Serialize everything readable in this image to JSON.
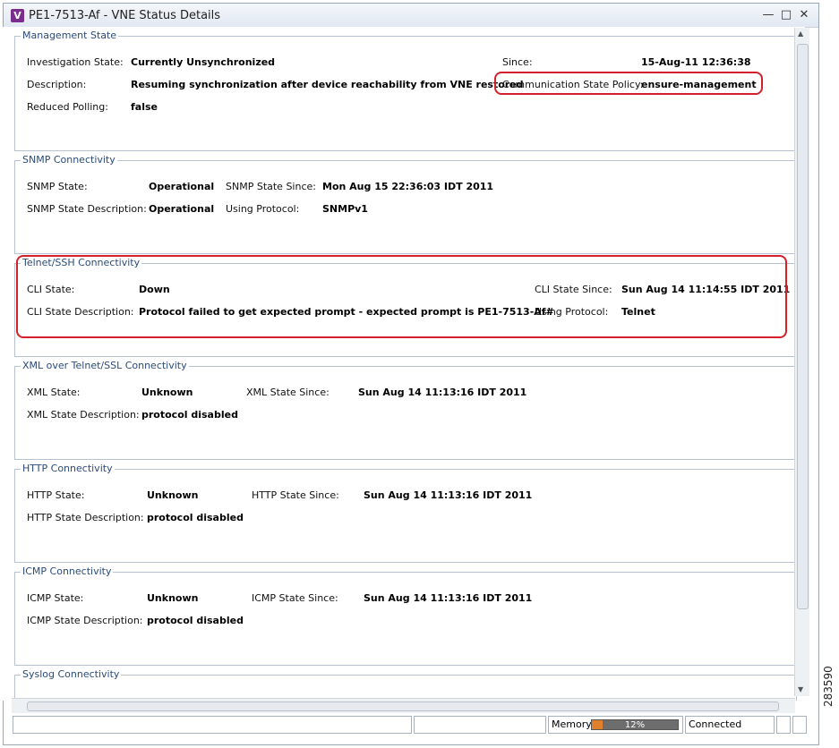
{
  "window": {
    "title": "PE1-7513-Af  - VNE Status Details",
    "icon_letter": "V"
  },
  "sections": {
    "management": {
      "title": "Management State",
      "investigation_label": "Investigation State:",
      "investigation_value": "Currently Unsynchronized",
      "description_label": "Description:",
      "description_value": "Resuming synchronization after device reachability from VNE restored",
      "reduced_label": "Reduced Polling:",
      "reduced_value": "false",
      "since_label": "Since:",
      "since_value": "15-Aug-11 12:36:38",
      "policy_label": "Communication State Policy:",
      "policy_value": "ensure-management"
    },
    "snmp": {
      "title": "SNMP Connectivity",
      "state_label": "SNMP State:",
      "state_value": "Operational",
      "desc_label": "SNMP State Description:",
      "desc_value": "Operational",
      "since_label": "SNMP State Since:",
      "since_value": "Mon Aug 15 22:36:03 IDT 2011",
      "protocol_label": "Using Protocol:",
      "protocol_value": "SNMPv1"
    },
    "telnet": {
      "title": "Telnet/SSH Connectivity",
      "state_label": "CLI State:",
      "state_value": "Down",
      "desc_label": "CLI State Description:",
      "desc_value": "Protocol failed to get expected prompt - expected prompt is PE1-7513-Af#",
      "since_label": "CLI State Since:",
      "since_value": "Sun Aug 14 11:14:55 IDT 2011",
      "protocol_label": "Using Protocol:",
      "protocol_value": "Telnet"
    },
    "xml": {
      "title": "XML over Telnet/SSL Connectivity",
      "state_label": "XML State:",
      "state_value": "Unknown",
      "desc_label": "XML State Description:",
      "desc_value": "protocol disabled",
      "since_label": "XML State Since:",
      "since_value": "Sun Aug 14 11:13:16 IDT 2011"
    },
    "http": {
      "title": "HTTP Connectivity",
      "state_label": "HTTP State:",
      "state_value": "Unknown",
      "desc_label": "HTTP State Description:",
      "desc_value": "protocol disabled",
      "since_label": "HTTP State Since:",
      "since_value": "Sun Aug 14 11:13:16 IDT 2011"
    },
    "icmp": {
      "title": "ICMP Connectivity",
      "state_label": "ICMP State:",
      "state_value": "Unknown",
      "desc_label": "ICMP State Description:",
      "desc_value": "protocol disabled",
      "since_label": "ICMP State Since:",
      "since_value": "Sun Aug 14 11:13:16 IDT 2011"
    },
    "syslog": {
      "title": "Syslog Connectivity"
    }
  },
  "statusbar": {
    "memory_label": "Memory:",
    "memory_percent": 12,
    "memory_text": "12%",
    "connection": "Connected"
  },
  "figure_id": "283590",
  "colors": {
    "section_title": "#2b4b7a",
    "highlight": "#d4202a",
    "memory_fill": "#e0802a"
  }
}
